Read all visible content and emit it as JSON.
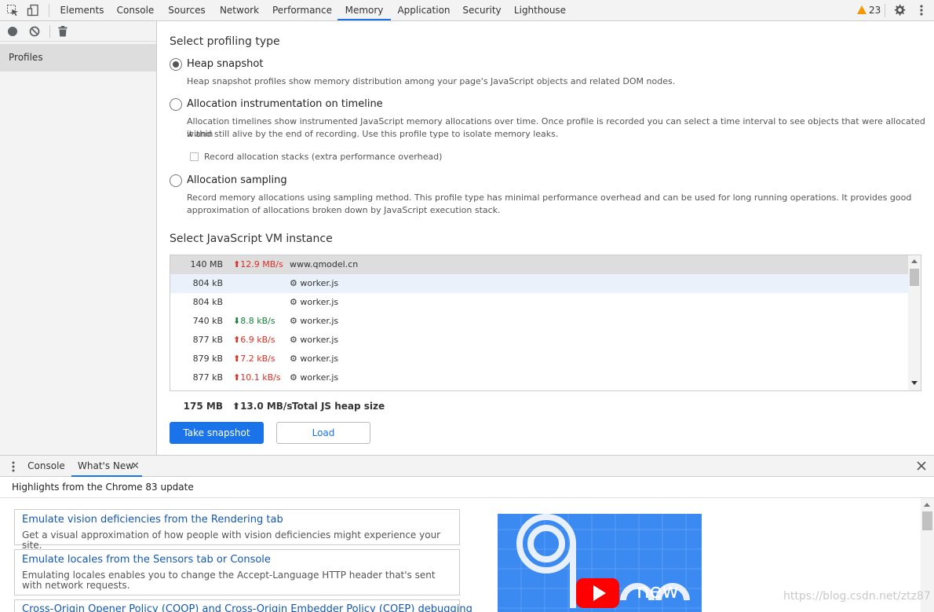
{
  "toolbar": {
    "tabs": [
      {
        "label": "Elements"
      },
      {
        "label": "Console"
      },
      {
        "label": "Sources"
      },
      {
        "label": "Network"
      },
      {
        "label": "Performance"
      },
      {
        "label": "Memory"
      },
      {
        "label": "Application"
      },
      {
        "label": "Security"
      },
      {
        "label": "Lighthouse"
      }
    ],
    "active_tab": "Memory",
    "warning_count": "23",
    "accent_color": "#1a73e8"
  },
  "sidebar": {
    "items": [
      {
        "label": "Profiles"
      }
    ]
  },
  "profiling": {
    "heading": "Select profiling type",
    "options": [
      {
        "label": "Heap snapshot",
        "selected": true,
        "description": "Heap snapshot profiles show memory distribution among your page's JavaScript objects and related DOM nodes."
      },
      {
        "label": "Allocation instrumentation on timeline",
        "selected": false,
        "description_line1": "Allocation timelines show instrumented JavaScript memory allocations over time. Once profile is recorded you can select a time interval to see objects that were allocated within",
        "description_line2": "it and still alive by the end of recording. Use this profile type to isolate memory leaks.",
        "checkbox_label": "Record allocation stacks (extra performance overhead)"
      },
      {
        "label": "Allocation sampling",
        "selected": false,
        "description_line1": "Record memory allocations using sampling method. This profile type has minimal performance overhead and can be used for long running operations. It provides good",
        "description_line2": "approximation of allocations broken down by JavaScript execution stack."
      }
    ]
  },
  "vm": {
    "heading": "Select JavaScript VM instance",
    "rows": [
      {
        "size": "140 MB",
        "rate": "12.9 MB/s",
        "direction": "up",
        "name": "www.qmodel.cn"
      },
      {
        "size": "804 kB",
        "rate": "",
        "direction": "",
        "name": "worker.js"
      },
      {
        "size": "804 kB",
        "rate": "",
        "direction": "",
        "name": "worker.js"
      },
      {
        "size": "740 kB",
        "rate": "8.8 kB/s",
        "direction": "down",
        "name": "worker.js"
      },
      {
        "size": "877 kB",
        "rate": "6.9 kB/s",
        "direction": "up",
        "name": "worker.js"
      },
      {
        "size": "879 kB",
        "rate": "7.2 kB/s",
        "direction": "up",
        "name": "worker.js"
      },
      {
        "size": "877 kB",
        "rate": "10.1 kB/s",
        "direction": "up",
        "name": "worker.js"
      }
    ],
    "total_size": "175 MB",
    "total_rate": "13.0 MB/s",
    "total_label": "Total JS heap size"
  },
  "actions": {
    "take_snapshot": "Take snapshot",
    "load": "Load"
  },
  "drawer": {
    "tabs": [
      {
        "label": "Console"
      },
      {
        "label": "What's New"
      }
    ],
    "active_tab": "What's New",
    "highlights_title": "Highlights from the Chrome 83 update",
    "cards": [
      {
        "title": "Emulate vision deficiencies from the Rendering tab",
        "description": "Get a visual approximation of how people with vision deficiencies might experience your site."
      },
      {
        "title": "Emulate locales from the Sensors tab or Console",
        "description": "Emulating locales enables you to change the Accept-Language HTTP header that's sent with network requests."
      },
      {
        "title": "Cross-Origin Opener Policy (COOP) and Cross-Origin Embedder Policy (COEP) debugging",
        "description": ""
      }
    ],
    "video_text": "new"
  },
  "watermark": "https://blog.csdn.net/ztz87"
}
